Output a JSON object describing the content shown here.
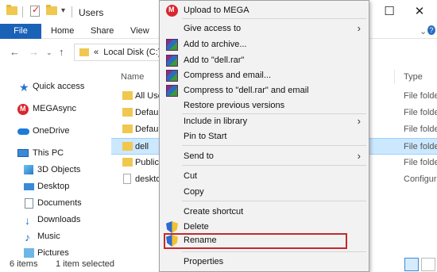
{
  "window": {
    "title": "Users",
    "minimize": "—",
    "maximize": "☐",
    "close": "✕"
  },
  "ribbon": {
    "file": "File",
    "tabs": [
      "Home",
      "Share",
      "View"
    ]
  },
  "address": {
    "prefix": "«",
    "path": "Local Disk (C:)"
  },
  "sidebar": {
    "items": [
      {
        "label": "Quick access",
        "icon": "star-icon"
      },
      {
        "label": "MEGAsync",
        "icon": "mega-icon"
      },
      {
        "label": "OneDrive",
        "icon": "cloud-icon"
      },
      {
        "label": "This PC",
        "icon": "computer-icon"
      },
      {
        "label": "3D Objects",
        "icon": "cube-icon"
      },
      {
        "label": "Desktop",
        "icon": "desktop-icon"
      },
      {
        "label": "Documents",
        "icon": "documents-icon"
      },
      {
        "label": "Downloads",
        "icon": "download-icon"
      },
      {
        "label": "Music",
        "icon": "music-icon"
      },
      {
        "label": "Pictures",
        "icon": "pictures-icon"
      }
    ]
  },
  "content": {
    "column_name": "Name",
    "column_type": "Type",
    "rows": [
      {
        "name": "All Use",
        "type": "File folde",
        "kind": "folder"
      },
      {
        "name": "Defaul",
        "type": "File folde",
        "kind": "folder"
      },
      {
        "name": "Defaul",
        "type": "File folde",
        "kind": "folder"
      },
      {
        "name": "dell",
        "type": "File folde",
        "kind": "folder",
        "selected": true
      },
      {
        "name": "Public",
        "type": "File folde",
        "kind": "folder"
      },
      {
        "name": "deskto",
        "type": "Configura",
        "kind": "file"
      }
    ]
  },
  "status": {
    "count": "6 items",
    "selected": "1 item selected"
  },
  "menu": {
    "items": [
      {
        "label": "Upload to MEGA",
        "icon": "mega-icon"
      },
      {
        "label": "Give access to",
        "submenu": true
      },
      {
        "label": "Add to archive...",
        "icon": "winrar-icon"
      },
      {
        "label": "Add to \"dell.rar\"",
        "icon": "winrar-icon"
      },
      {
        "label": "Compress and email...",
        "icon": "winrar-icon"
      },
      {
        "label": "Compress to \"dell.rar\" and email",
        "icon": "winrar-icon"
      },
      {
        "label": "Restore previous versions"
      },
      {
        "label": "Include in library",
        "submenu": true
      },
      {
        "label": "Pin to Start"
      },
      {
        "label": "Send to",
        "submenu": true
      },
      {
        "label": "Cut"
      },
      {
        "label": "Copy"
      },
      {
        "label": "Create shortcut"
      },
      {
        "label": "Delete",
        "icon": "shield-icon"
      },
      {
        "label": "Rename",
        "icon": "shield-icon",
        "highlighted": true
      },
      {
        "label": "Properties"
      }
    ],
    "submenu_arrow": "›"
  },
  "colors": {
    "file_tab": "#1a62b8",
    "selection": "#cce8ff",
    "highlight_border": "#c42b2b",
    "menu_bg": "#f2f2f2"
  }
}
